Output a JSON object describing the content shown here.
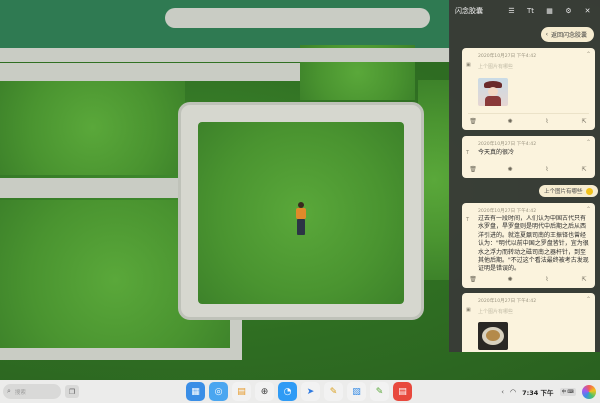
{
  "panel": {
    "title": "闪念胶囊",
    "header_icons": [
      "list-icon",
      "text-size-icon",
      "grid-icon",
      "settings-icon",
      "close-icon"
    ],
    "header_text_size": "Tt",
    "return_label": "返回闪念胶囊"
  },
  "cards": [
    {
      "timestamp": "2020年10月27日 下午4:42",
      "hint": "上个图片有哪些",
      "text": "",
      "image": "anime-character"
    },
    {
      "timestamp": "2020年10月27日 下午4:42",
      "hint": "",
      "text": "今天真的很冷",
      "image": ""
    },
    {
      "timestamp": "2020年10月27日 下午4:42",
      "hint": "",
      "text": "过去有一段时间，人们认为中国古代只有水罗盘，旱罗盘则是明代中后期之后从西洋引进的。就连夏鼐司南的王振铎也曾经认为：\"明代以前中国之罗盘皆针，宜为很水之浮力而转动之磁司南之器杆针，到至其他后期。\"不过这个看法最终被考古发现证明是错误的。",
      "image": ""
    },
    {
      "timestamp": "2020年10月27日 下午4:42",
      "hint": "上个图片有哪些",
      "text": "",
      "image": "food-bowl"
    }
  ],
  "pill": {
    "label": "上个图片有哪些"
  },
  "card_actions": [
    "trash-icon",
    "sun-icon",
    "attach-icon",
    "share-icon"
  ],
  "taskbar": {
    "search_placeholder": "搜索",
    "time": "7:34 下午",
    "badge": "中 ⌨",
    "apps": [
      {
        "name": "launcher",
        "color": "#3a8ee6",
        "glyph": "▦"
      },
      {
        "name": "multitask",
        "color": "#4aa6f0",
        "glyph": "◎"
      },
      {
        "name": "files",
        "color": "#f2f2f2",
        "glyph": "🗂"
      },
      {
        "name": "mirror",
        "color": "#f2f2f2",
        "glyph": "⊕"
      },
      {
        "name": "browser",
        "color": "#2f9bf5",
        "glyph": "◔"
      },
      {
        "name": "send",
        "color": "#f2f2f2",
        "glyph": "➤"
      },
      {
        "name": "notes",
        "color": "#f2f2f2",
        "glyph": "✎"
      },
      {
        "name": "gallery",
        "color": "#f2f2f2",
        "glyph": "▧"
      },
      {
        "name": "sticky",
        "color": "#f2f2f2",
        "glyph": "✎"
      },
      {
        "name": "calendar",
        "color": "#e8493d",
        "glyph": "▤"
      }
    ]
  }
}
